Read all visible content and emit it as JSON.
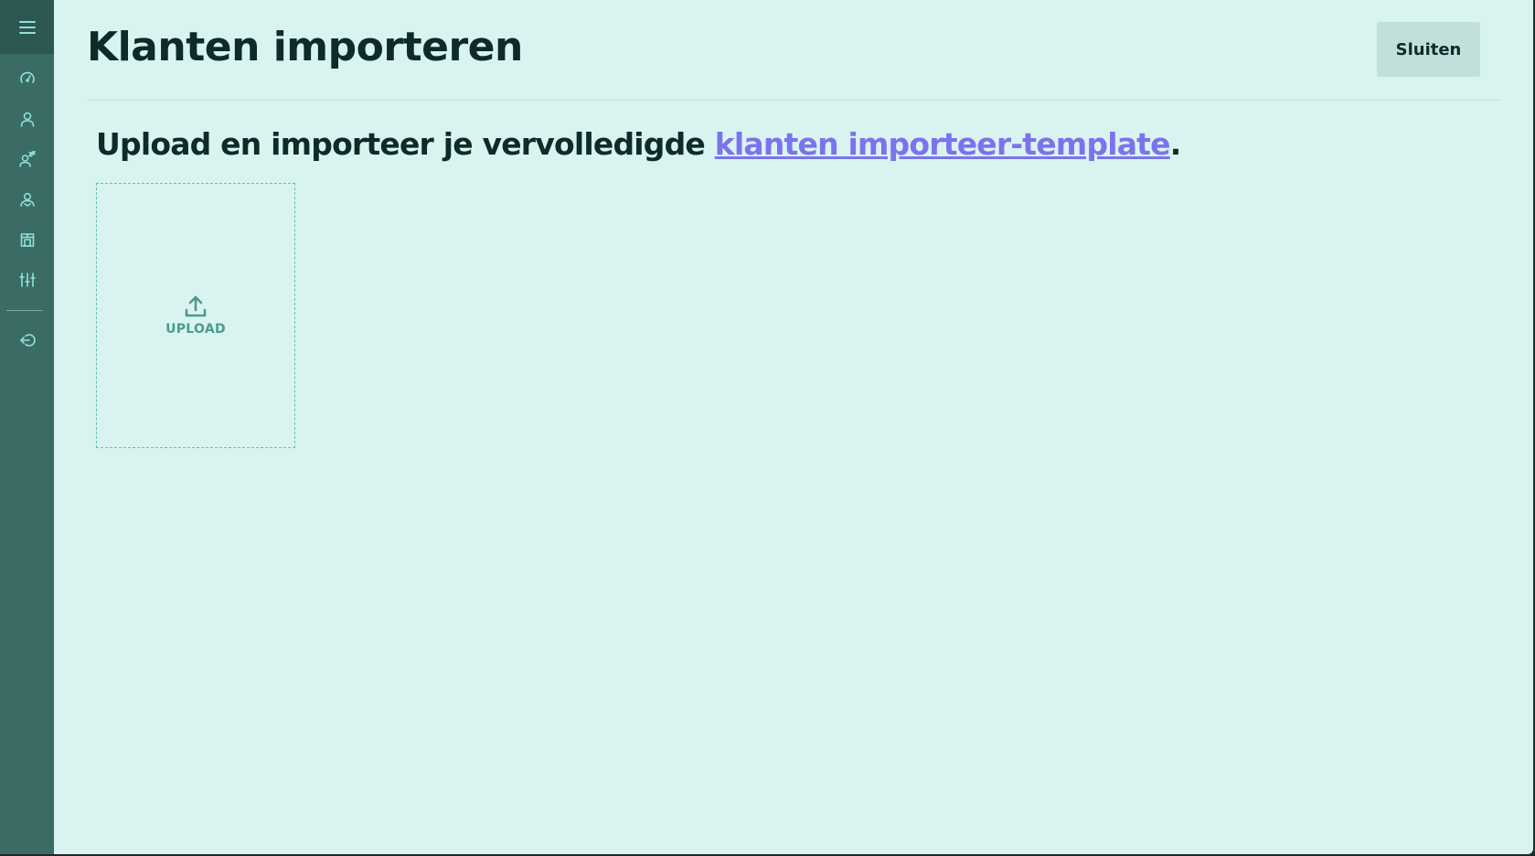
{
  "page": {
    "title": "Klanten importeren",
    "close_label": "Sluiten"
  },
  "sidebar": {
    "items": [
      {
        "name": "dashboard",
        "icon": "speedometer-icon"
      },
      {
        "name": "customers",
        "icon": "user-icon"
      },
      {
        "name": "inactive-customers",
        "icon": "user-sleep-icon"
      },
      {
        "name": "employees",
        "icon": "user-group-icon"
      },
      {
        "name": "shop",
        "icon": "store-icon"
      },
      {
        "name": "settings",
        "icon": "sliders-icon"
      },
      {
        "name": "logout",
        "icon": "logout-icon"
      }
    ]
  },
  "instruction": {
    "prefix": "Upload en importeer je vervolledigde ",
    "link_text": "klanten importeer-template",
    "suffix": "."
  },
  "upload": {
    "label": "UPLOAD",
    "icon": "upload-icon"
  },
  "colors": {
    "sidebar": "#3a6b65",
    "background": "#d9f4f0",
    "accent_link": "#7b73ee",
    "icon": "#8fe3d6"
  }
}
